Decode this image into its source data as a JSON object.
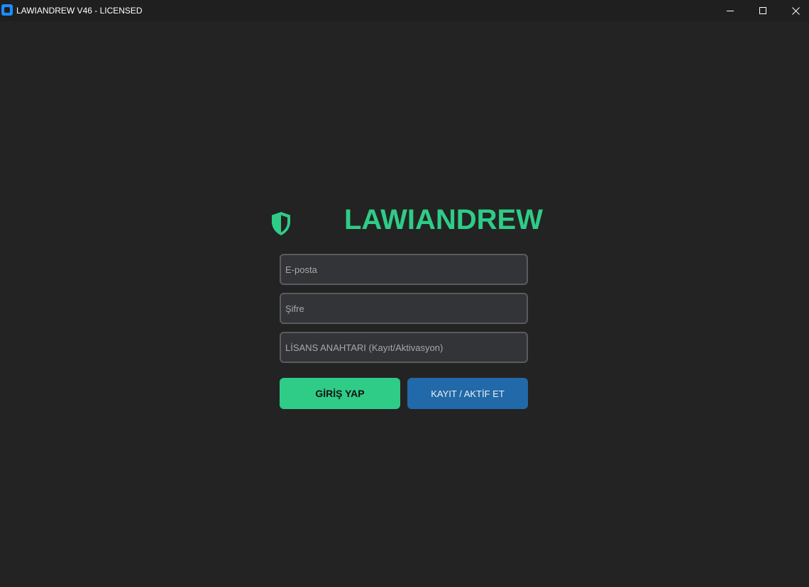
{
  "window": {
    "title": "LAWIANDREW V46 - LICENSED",
    "controls": [
      "minimize-icon",
      "maximize-icon",
      "close-icon"
    ]
  },
  "brand": {
    "name": "LAWIANDREW",
    "icon": "shield-icon",
    "color": "#2ecc87"
  },
  "form": {
    "email_placeholder": "E-posta",
    "password_placeholder": "Şifre",
    "license_placeholder": "LİSANS ANAHTARI (Kayıt/Aktivasyon)"
  },
  "buttons": {
    "login_label": "GİRİŞ YAP",
    "register_label": "KAYIT / AKTİF ET",
    "login_color": "#2ecc87",
    "register_color": "#2169a8"
  }
}
